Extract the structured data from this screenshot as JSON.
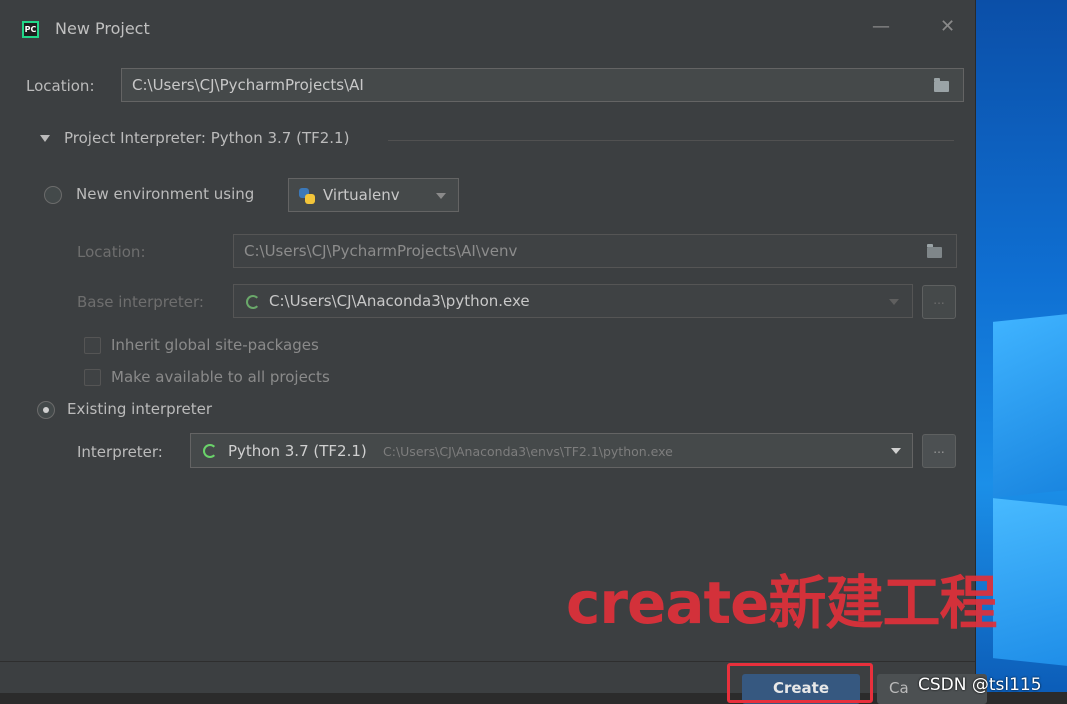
{
  "window": {
    "title": "New Project",
    "minimize": "—",
    "close": "✕"
  },
  "location": {
    "label": "Location:",
    "value": "C:\\Users\\CJ\\PycharmProjects\\AI"
  },
  "interpreter_section": {
    "label": "Project Interpreter: Python 3.7 (TF2.1)"
  },
  "new_env": {
    "radio_label": "New environment using",
    "tool": "Virtualenv",
    "location_label": "Location:",
    "location_value": "C:\\Users\\CJ\\PycharmProjects\\AI\\venv",
    "base_label": "Base interpreter:",
    "base_value": "C:\\Users\\CJ\\Anaconda3\\python.exe",
    "inherit_label": "Inherit global site-packages",
    "available_label": "Make available to all projects",
    "browse": "..."
  },
  "existing": {
    "radio_label": "Existing interpreter",
    "interpreter_label": "Interpreter:",
    "interpreter_name": "Python 3.7 (TF2.1)",
    "interpreter_path": "C:\\Users\\CJ\\Anaconda3\\envs\\TF2.1\\python.exe",
    "browse": "..."
  },
  "buttons": {
    "create": "Create",
    "cancel": "Ca"
  },
  "annotation": "create新建工程",
  "watermark": "CSDN @tsl115",
  "colors": {
    "accent": "#365880",
    "highlight": "#e8303c",
    "background": "#3c3f41"
  }
}
